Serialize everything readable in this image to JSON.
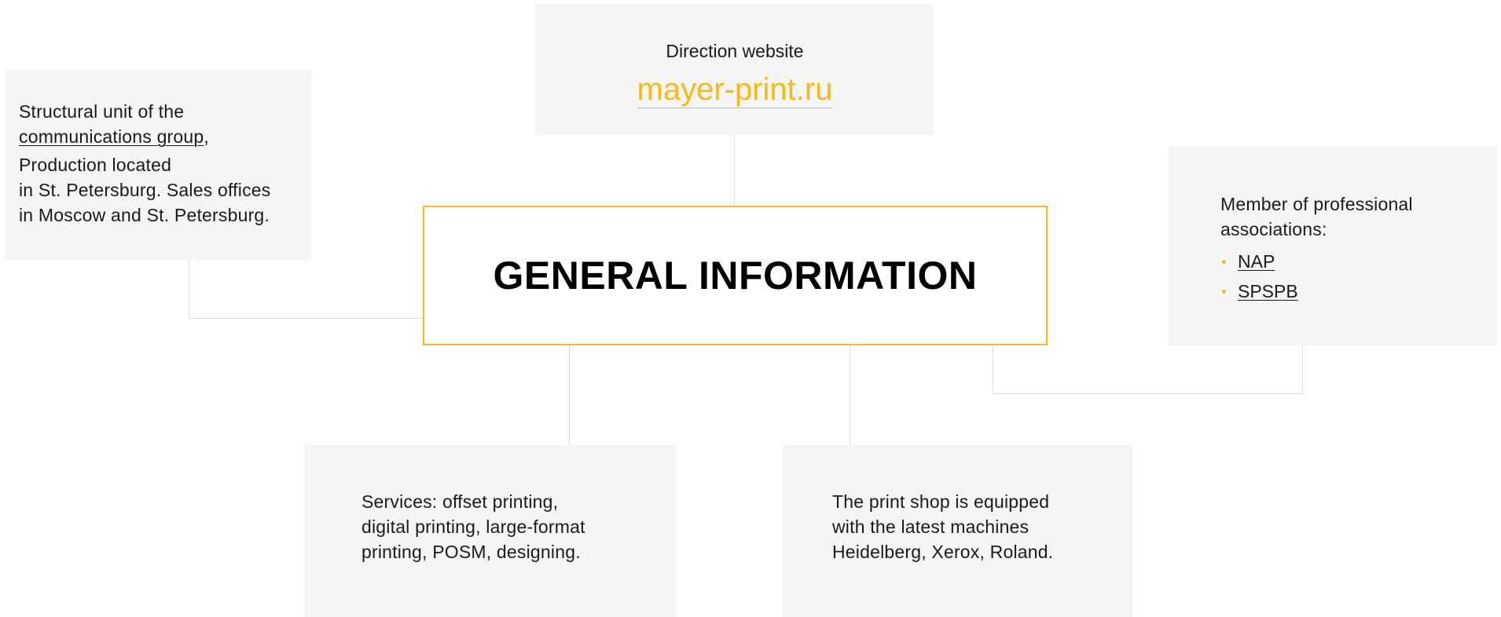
{
  "center": {
    "title": "GENERAL INFORMATION"
  },
  "website": {
    "label": "Direction website",
    "link": "mayer-print.ru"
  },
  "structure": {
    "line1": "Structural unit of the",
    "link": "communications group",
    "after_link": ",",
    "line3": "Production located",
    "line4": "in St. Petersburg. Sales offices",
    "line5": "in Moscow and St. Petersburg."
  },
  "associations": {
    "title": "Member  of professional associations:",
    "items": [
      {
        "label": "NAP"
      },
      {
        "label": "SPSPB"
      }
    ]
  },
  "services": {
    "line1": "Services: offset printing,",
    "line2": "digital printing, large-format",
    "line3": "printing, POSM, designing."
  },
  "equipment": {
    "line1": "The print shop is equipped",
    "line2": "with the latest machines",
    "line3": "Heidelberg, Xerox, Roland."
  },
  "colors": {
    "accent": "#f5b91c",
    "card_bg": "#f5f5f5",
    "connector": "#dedede",
    "text": "#1a1a1a"
  }
}
